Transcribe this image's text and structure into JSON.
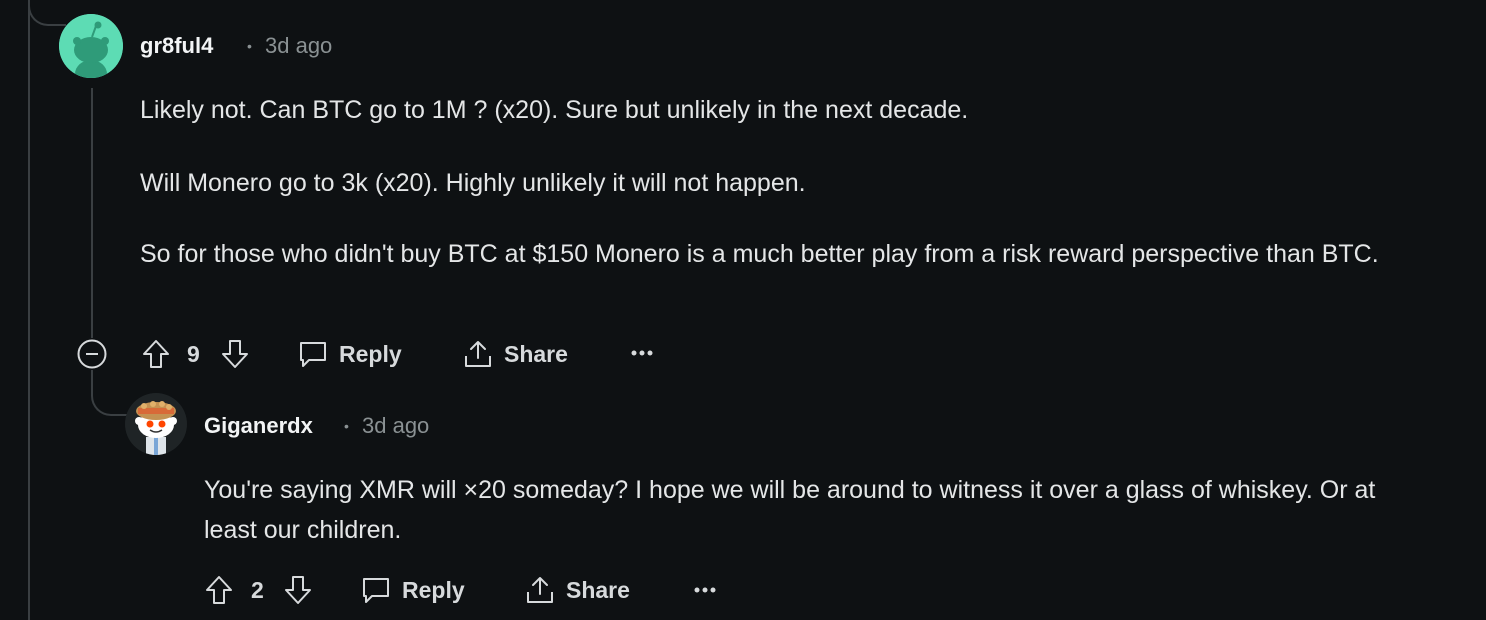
{
  "comments": [
    {
      "username": "gr8ful4",
      "separator": "•",
      "time": "3d ago",
      "paragraphs": [
        "Likely not. Can BTC go to 1M ? (x20). Sure but unlikely in the next decade.",
        "Will Monero go to 3k (x20). Highly unlikely it will not happen.",
        "So for those who didn't buy BTC at $150 Monero is a much better play from a risk reward perspective than BTC."
      ],
      "score": "9",
      "reply_label": "Reply",
      "share_label": "Share"
    },
    {
      "username": "Giganerdx",
      "separator": "•",
      "time": "3d ago",
      "paragraphs": [
        "You're saying XMR will ×20 someday? I hope we will be around to witness it over a glass of whiskey. Or at least our children."
      ],
      "score": "2",
      "reply_label": "Reply",
      "share_label": "Share"
    }
  ],
  "icons": {
    "upvote": "upvote-arrow-icon",
    "downvote": "downvote-arrow-icon",
    "reply": "speech-bubble-icon",
    "share": "share-upload-icon",
    "more": "ellipsis-icon",
    "collapse": "collapse-minus-icon"
  },
  "colors": {
    "background": "#0e1113",
    "thread_line": "#3a3f42",
    "text": "#e4e6e7",
    "muted": "#8a9193",
    "avatar1": "#5ddcb4"
  }
}
